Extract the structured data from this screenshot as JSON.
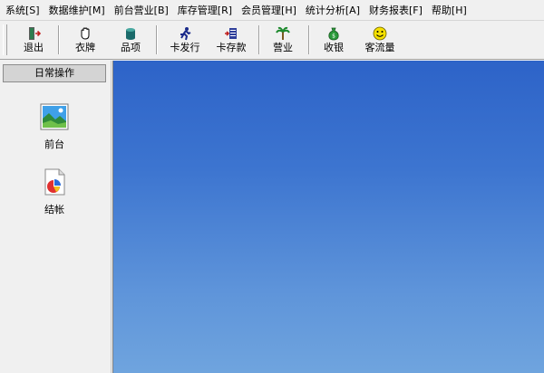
{
  "menubar": {
    "items": [
      "系统[S]",
      "数据维护[M]",
      "前台营业[B]",
      "库存管理[R]",
      "会员管理[H]",
      "统计分析[A]",
      "财务报表[F]",
      "帮助[H]"
    ]
  },
  "toolbar": {
    "buttons": [
      {
        "label": "退出",
        "icon": "exit-door-icon"
      },
      {
        "label": "衣牌",
        "icon": "hand-icon"
      },
      {
        "label": "品项",
        "icon": "cylinder-icon"
      },
      {
        "label": "卡发行",
        "icon": "runner-icon"
      },
      {
        "label": "卡存款",
        "icon": "card-deposit-icon"
      },
      {
        "label": "营业",
        "icon": "palm-tree-icon"
      },
      {
        "label": "收银",
        "icon": "money-bag-icon"
      },
      {
        "label": "客流量",
        "icon": "smiley-icon"
      }
    ]
  },
  "leftpanel": {
    "header": "日常操作",
    "items": [
      {
        "label": "前台",
        "icon": "landscape-picture-icon"
      },
      {
        "label": "结帐",
        "icon": "document-chart-icon"
      }
    ]
  },
  "colors": {
    "desktop_top": "#2d63c8",
    "desktop_bottom": "#6fa4de",
    "chrome": "#f0f0f0"
  }
}
